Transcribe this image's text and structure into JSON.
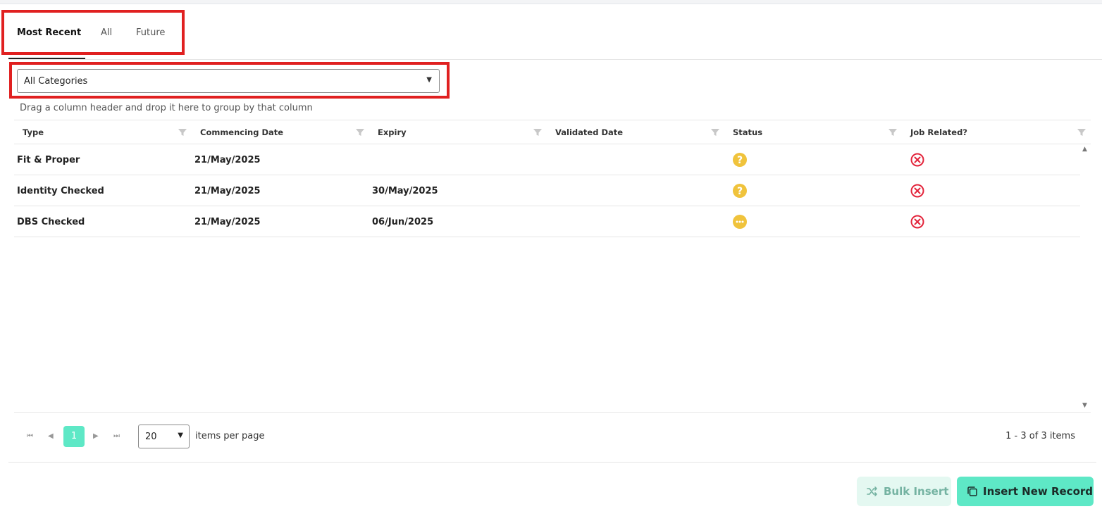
{
  "tabs": [
    {
      "label": "Most Recent",
      "active": true
    },
    {
      "label": "All",
      "active": false
    },
    {
      "label": "Future",
      "active": false
    }
  ],
  "category_filter": {
    "selected": "All Categories"
  },
  "group_hint": "Drag a column header and drop it here to group by that column",
  "columns": [
    "Type",
    "Commencing Date",
    "Expiry",
    "Validated Date",
    "Status",
    "Job Related?"
  ],
  "rows": [
    {
      "type": "Fit & Proper",
      "commencing": "21/May/2025",
      "expiry": "",
      "validated": "",
      "status": "question-icon",
      "job_related": "cross-circle-icon"
    },
    {
      "type": "Identity Checked",
      "commencing": "21/May/2025",
      "expiry": "30/May/2025",
      "validated": "",
      "status": "question-icon",
      "job_related": "cross-circle-icon"
    },
    {
      "type": "DBS Checked",
      "commencing": "21/May/2025",
      "expiry": "06/Jun/2025",
      "validated": "",
      "status": "pending-dots-icon",
      "job_related": "cross-circle-icon"
    }
  ],
  "pager": {
    "current_page": "1",
    "page_size": "20",
    "per_page_label": "items per page",
    "info": "1 - 3 of 3 items"
  },
  "actions": {
    "bulk_insert": "Bulk Insert",
    "insert_new": "Insert New Record"
  },
  "colors": {
    "accent": "#5ee8c6",
    "highlight_border": "#e02020",
    "status_yellow": "#f0c33c",
    "error_red": "#e3243b"
  }
}
